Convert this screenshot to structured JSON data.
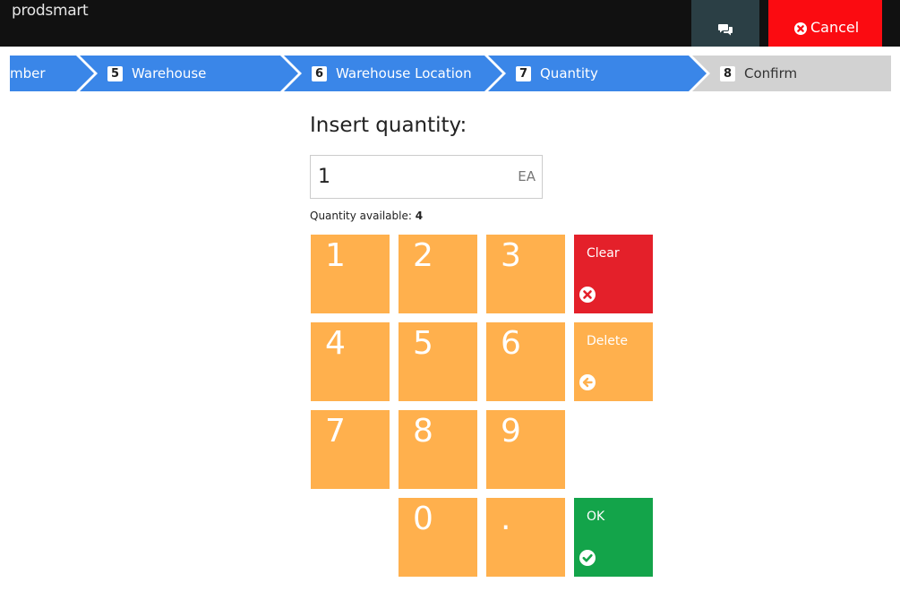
{
  "app": {
    "brand": "prodsmart"
  },
  "header": {
    "cancel_label": "Cancel"
  },
  "steps": [
    {
      "number": "",
      "label": "mber",
      "state": "done"
    },
    {
      "number": "5",
      "label": "Warehouse",
      "state": "done"
    },
    {
      "number": "6",
      "label": "Warehouse Location",
      "state": "done"
    },
    {
      "number": "7",
      "label": "Quantity",
      "state": "active"
    },
    {
      "number": "8",
      "label": "Confirm",
      "state": "pending"
    }
  ],
  "form": {
    "title": "Insert quantity:",
    "value": "1",
    "unit": "EA",
    "available_label": "Quantity available:",
    "available_value": "4"
  },
  "keypad": {
    "keys": [
      "1",
      "2",
      "3",
      "4",
      "5",
      "6",
      "7",
      "8",
      "9",
      "0",
      "."
    ],
    "clear_label": "Clear",
    "delete_label": "Delete",
    "ok_label": "OK"
  },
  "colors": {
    "header_bg": "#111111",
    "cancel_bg": "#fb0b11",
    "chat_bg": "#2b3f45",
    "step_active": "#3a86e8",
    "step_inactive": "#d2d2d2",
    "key_orange": "#ffb04d",
    "clear_red": "#e4202a",
    "ok_green": "#13a44a"
  },
  "icons": {
    "chat": "comments-icon",
    "cancel": "times-circle-icon",
    "clear": "times-circle-icon",
    "delete": "arrow-circle-left-icon",
    "ok": "check-circle-icon"
  }
}
